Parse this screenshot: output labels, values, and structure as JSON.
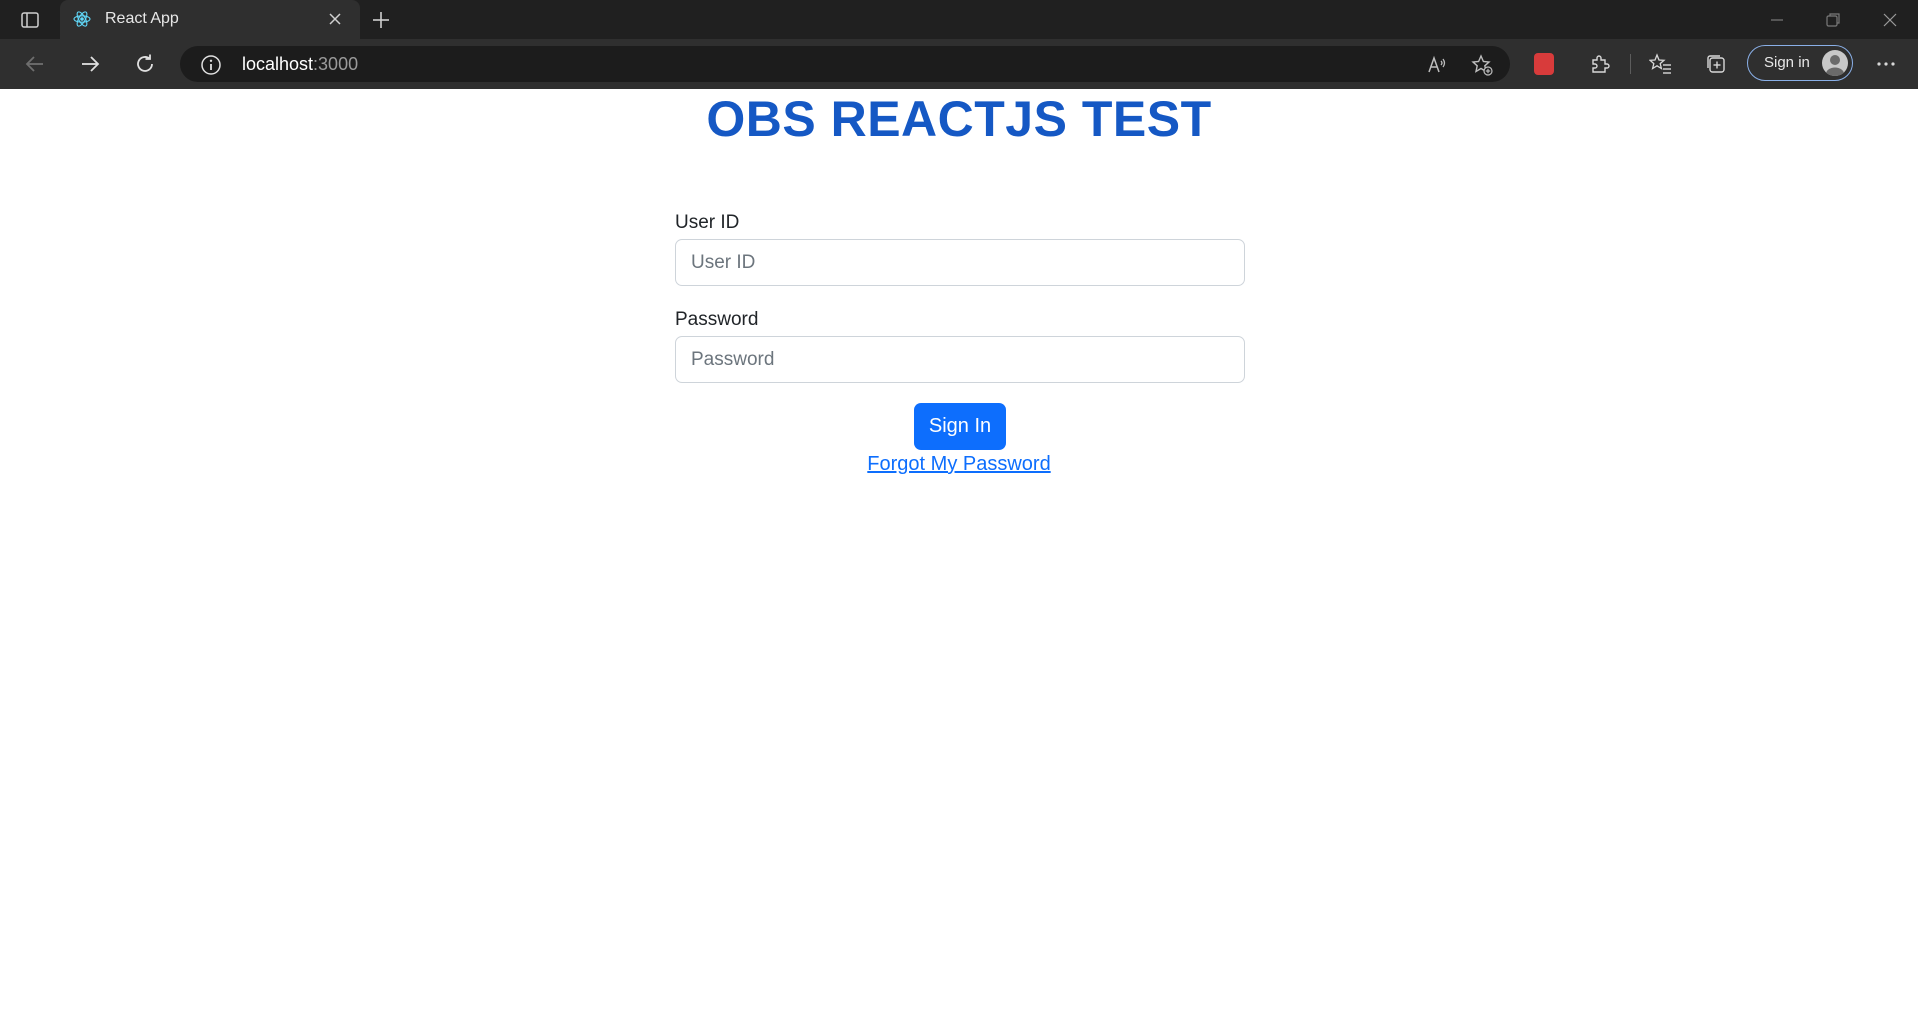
{
  "browser": {
    "tab": {
      "title": "React App",
      "favicon": "react-logo-icon"
    },
    "address": {
      "host": "localhost",
      "port": ":3000"
    },
    "profile": {
      "signin_label": "Sign in"
    }
  },
  "page": {
    "title": "OBS REACTJS TEST",
    "user_id": {
      "label": "User ID",
      "placeholder": "User ID",
      "value": ""
    },
    "password": {
      "label": "Password",
      "placeholder": "Password",
      "value": ""
    },
    "signin_button": "Sign In",
    "forgot_link": "Forgot My Password"
  },
  "colors": {
    "title": "#1558c4",
    "button": "#0d6efd",
    "link": "#0d6efd",
    "browser_frame": "#202020",
    "toolbar": "#2f2f2f"
  }
}
